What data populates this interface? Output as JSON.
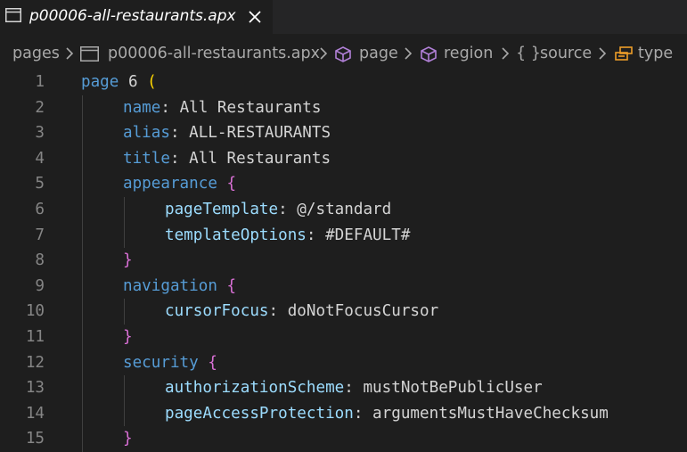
{
  "tab": {
    "title": "p00006-all-restaurants.apx",
    "file_icon": "file-icon",
    "close_icon": "close-icon"
  },
  "breadcrumb": {
    "items": [
      {
        "label": "pages",
        "icon": null
      },
      {
        "label": "p00006-all-restaurants.apx",
        "icon": "file-icon"
      },
      {
        "label": "page",
        "icon": "cube-icon"
      },
      {
        "label": "region",
        "icon": "cube-icon"
      },
      {
        "label": "source",
        "icon": "braces-icon"
      },
      {
        "label": "type",
        "icon": "field-icon"
      }
    ],
    "braces_glyph": "{ }"
  },
  "editor": {
    "lines": [
      {
        "num": "1",
        "key": "page",
        "sep": " ",
        "value": "6",
        "open": "(",
        "level": 0
      },
      {
        "num": "2",
        "key": "name",
        "sep": ": ",
        "value": "All Restaurants",
        "level": 1
      },
      {
        "num": "3",
        "key": "alias",
        "sep": ": ",
        "value": "ALL-RESTAURANTS",
        "level": 1
      },
      {
        "num": "4",
        "key": "title",
        "sep": ": ",
        "value": "All Restaurants",
        "level": 1
      },
      {
        "num": "5",
        "key": "appearance",
        "sep": " ",
        "open": "{",
        "level": 1
      },
      {
        "num": "6",
        "key": "pageTemplate",
        "sep": ": ",
        "value": "@/standard",
        "level": 2
      },
      {
        "num": "7",
        "key": "templateOptions",
        "sep": ": ",
        "value": "#DEFAULT#",
        "level": 2
      },
      {
        "num": "8",
        "close": "}",
        "level": 1
      },
      {
        "num": "9",
        "key": "navigation",
        "sep": " ",
        "open": "{",
        "level": 1
      },
      {
        "num": "10",
        "key": "cursorFocus",
        "sep": ": ",
        "value": "doNotFocusCursor",
        "level": 2
      },
      {
        "num": "11",
        "close": "}",
        "level": 1
      },
      {
        "num": "12",
        "key": "security",
        "sep": " ",
        "open": "{",
        "level": 1
      },
      {
        "num": "13",
        "key": "authorizationScheme",
        "sep": ": ",
        "value": "mustNotBePublicUser",
        "level": 2
      },
      {
        "num": "14",
        "key": "pageAccessProtection",
        "sep": ": ",
        "value": "argumentsMustHaveChecksum",
        "level": 2
      },
      {
        "num": "15",
        "close": "}",
        "level": 1
      }
    ]
  },
  "colors": {
    "background": "#1e1e1e",
    "line_number": "#858585",
    "keyword": "#569cd6",
    "property": "#9cdcfe",
    "text": "#d4d4d4",
    "bracket_level_1": "#ffd700",
    "bracket_level_2": "#da70d6",
    "symbol_icon": "#b180d7",
    "field_icon": "#ee9d28"
  }
}
